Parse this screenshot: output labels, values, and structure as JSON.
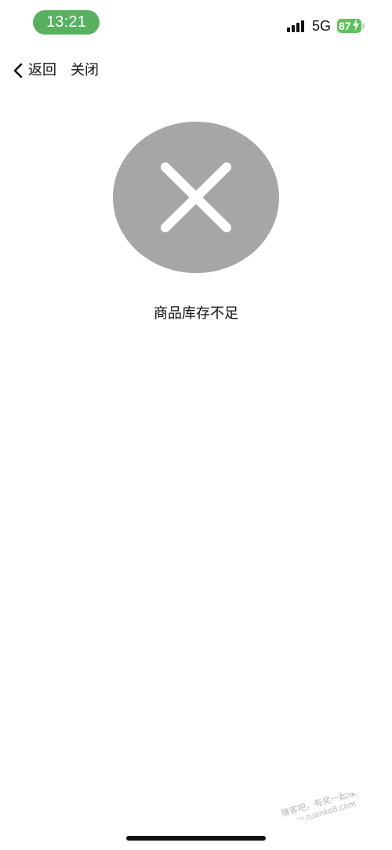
{
  "status_bar": {
    "time": "13:21",
    "network": "5G",
    "battery_level": "87",
    "battery_charging": true,
    "time_pill_color": "#57b15f",
    "battery_color": "#5cc35a",
    "signal_icon": "cellular-signal-icon"
  },
  "nav": {
    "back_label": "返回",
    "close_label": "关闭",
    "back_icon": "chevron-left-icon"
  },
  "result": {
    "icon": "error-x-icon",
    "icon_color": "#a6a6a6",
    "message": "商品库存不足"
  },
  "watermark": {
    "line1": "赚客吧，有奖一起赚！",
    "line2": "www.zuanke8.com"
  }
}
